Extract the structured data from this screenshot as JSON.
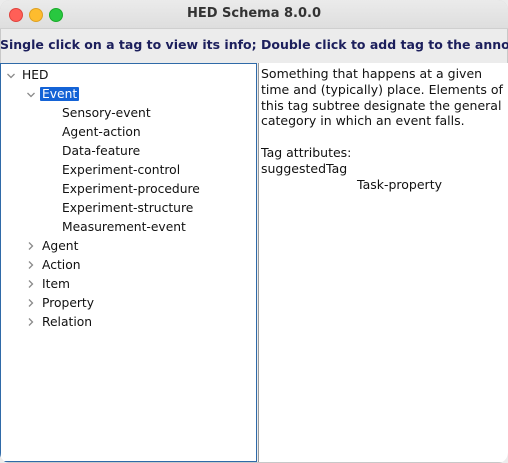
{
  "window": {
    "title": "HED Schema 8.0.0"
  },
  "instruction": "Single click on a tag to view its info; Double click to add tag to the annotation",
  "tree": {
    "root": "HED",
    "selected": "Event",
    "event_children": [
      "Sensory-event",
      "Agent-action",
      "Data-feature",
      "Experiment-control",
      "Experiment-procedure",
      "Experiment-structure",
      "Measurement-event"
    ],
    "collapsed_nodes": [
      "Agent",
      "Action",
      "Item",
      "Property",
      "Relation"
    ]
  },
  "info": {
    "description": "Something that happens at a given time and (typically) place. Elements of this tag subtree designate the general category in which an event falls.",
    "attributes_heading": "Tag attributes:",
    "attribute_name": "suggestedTag",
    "attribute_value": "Task-property"
  }
}
